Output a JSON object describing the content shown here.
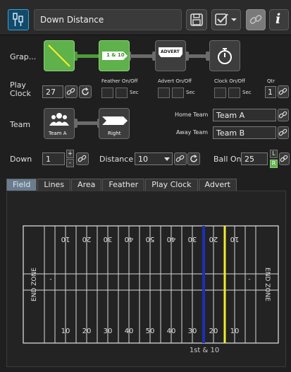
{
  "header": {
    "title": "Down Distance",
    "info_label": "i"
  },
  "graphics": {
    "label": "Grap...",
    "nodes": [
      "1 & 10",
      "ADVERT"
    ]
  },
  "play_clock": {
    "label": "Play Clock",
    "value": "27",
    "feather_label": "Feather On/Off",
    "advert_label": "Advert On/Off",
    "clock_label": "Clock On/Off",
    "sec_label": "Sec",
    "qtr_label": "Qtr",
    "qtr_value": "1"
  },
  "team": {
    "label": "Team",
    "node_label": "Team A",
    "direction_label": "Right",
    "home_label": "Home Team",
    "home_value": "Team A",
    "away_label": "Away Team",
    "away_value": "Team B"
  },
  "down": {
    "label": "Down",
    "value": "1",
    "plus": "+",
    "minus": "-",
    "distance_label": "Distance",
    "distance_value": "10",
    "ball_on_label": "Ball On",
    "ball_on_value": "25",
    "l_label": "L",
    "r_label": "R"
  },
  "tabs": [
    "Field",
    "Lines",
    "Area",
    "Feather",
    "Play Clock",
    "Advert"
  ],
  "field": {
    "end_zone_label": "END ZONE",
    "yard_numbers": [
      "10",
      "20",
      "30",
      "40",
      "50",
      "40",
      "30",
      "20",
      "10"
    ],
    "hash_mark": "-",
    "caption": "1st & 10"
  },
  "colors": {
    "accent_green": "#5fb14b",
    "scrimmage_line": "#1d2fb5",
    "first_down_line": "#f2ee2a",
    "active_tab": "#6a7d8f"
  }
}
